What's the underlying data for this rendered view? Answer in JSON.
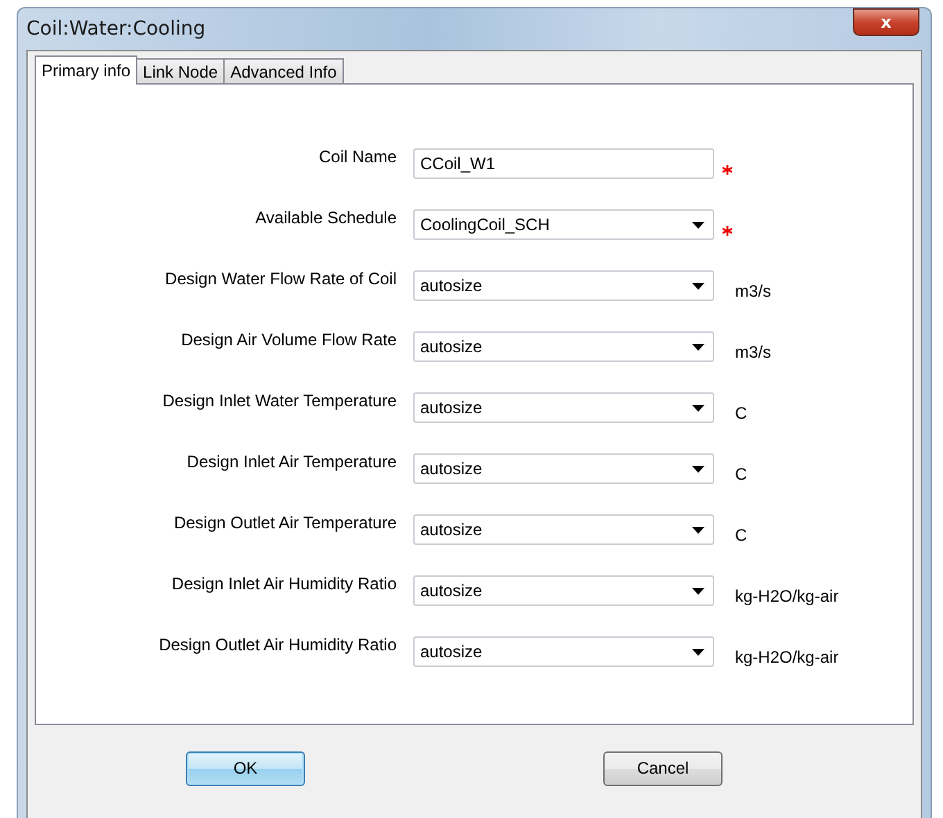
{
  "window": {
    "title": "Coil:Water:Cooling",
    "close": "x"
  },
  "tabs": [
    {
      "label": "Primary info",
      "selected": true
    },
    {
      "label": "Link Node",
      "selected": false
    },
    {
      "label": "Advanced Info",
      "selected": false
    }
  ],
  "fields": [
    {
      "label": "Coil Name",
      "kind": "text",
      "value": "CCoil_W1",
      "required": true
    },
    {
      "label": "Available Schedule",
      "kind": "combo",
      "value": "CoolingCoil_SCH",
      "required": true
    },
    {
      "label": "Design Water Flow Rate of Coil",
      "kind": "combo",
      "value": "autosize",
      "required": false,
      "unit": "m3/s"
    },
    {
      "label": "Design Air Volume Flow Rate",
      "kind": "combo",
      "value": "autosize",
      "required": false,
      "unit": "m3/s"
    },
    {
      "label": "Design Inlet Water Temperature",
      "kind": "combo",
      "value": "autosize",
      "required": false,
      "unit": "C"
    },
    {
      "label": "Design Inlet Air Temperature",
      "kind": "combo",
      "value": "autosize",
      "required": false,
      "unit": "C"
    },
    {
      "label": "Design Outlet Air Temperature",
      "kind": "combo",
      "value": "autosize",
      "required": false,
      "unit": "C"
    },
    {
      "label": "Design Inlet Air Humidity Ratio",
      "kind": "combo",
      "value": "autosize",
      "required": false,
      "unit": "kg-H2O/kg-air"
    },
    {
      "label": "Design Outlet Air Humidity Ratio",
      "kind": "combo",
      "value": "autosize",
      "required": false,
      "unit": "kg-H2O/kg-air"
    }
  ],
  "buttons": [
    {
      "label": "OK",
      "default": true
    },
    {
      "label": "Cancel",
      "default": false
    }
  ]
}
